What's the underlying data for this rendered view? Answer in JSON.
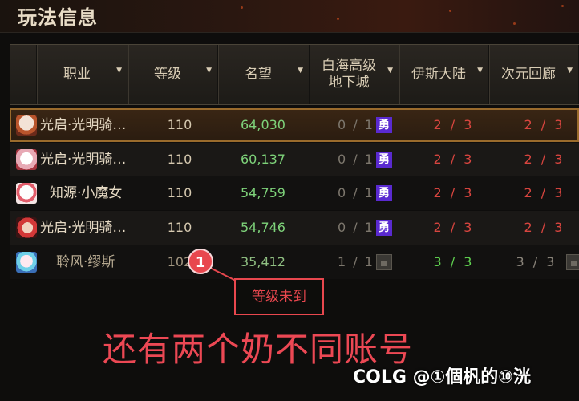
{
  "window": {
    "title": "玩法信息"
  },
  "columns": [
    {
      "label": "职业"
    },
    {
      "label": "等级"
    },
    {
      "label": "名望"
    },
    {
      "label": "白海高级\n地下城"
    },
    {
      "label": "伊斯大陆"
    },
    {
      "label": "次元回廊"
    }
  ],
  "rows": [
    {
      "name": "光启·光明骑…",
      "level": "110",
      "fame": "64,030",
      "dungeon": "0 / 1",
      "badge": "勇",
      "isle": "2 / 3",
      "corridor": "2 / 3"
    },
    {
      "name": "光启·光明骑…",
      "level": "110",
      "fame": "60,137",
      "dungeon": "0 / 1",
      "badge": "勇",
      "isle": "2 / 3",
      "corridor": "2 / 3"
    },
    {
      "name": "知源·小魔女",
      "level": "110",
      "fame": "54,759",
      "dungeon": "0 / 1",
      "badge": "勇",
      "isle": "2 / 3",
      "corridor": "2 / 3"
    },
    {
      "name": "光启·光明骑…",
      "level": "110",
      "fame": "54,746",
      "dungeon": "0 / 1",
      "badge": "勇",
      "isle": "2 / 3",
      "corridor": "2 / 3"
    },
    {
      "name": "聆风·缪斯",
      "level": "102",
      "fame": "35,412",
      "dungeon": "1 / 1",
      "isle": "3 / 3",
      "corridor": "3 / 3"
    }
  ],
  "annotation": {
    "marker": "1",
    "callout": "等级未到",
    "caption": "还有两个奶不同账号"
  },
  "watermark": "COLG @①個杋的⑩洸",
  "colors": {
    "accent_red": "#e8474e",
    "fame_green": "#7ed37a",
    "badge_purple": "#5a2ad0"
  }
}
